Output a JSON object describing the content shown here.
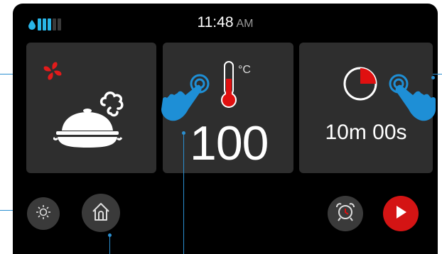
{
  "status_bar": {
    "time": "11:48",
    "ampm": "AM",
    "water_level_bars_filled": 3,
    "water_level_bars_total": 5,
    "water_icon": "water-drop-icon"
  },
  "tiles": {
    "mode": {
      "icons": [
        "convection-fan-icon",
        "covered-dish-steam-icon"
      ]
    },
    "temperature": {
      "value": "100",
      "unit": "°C",
      "icons": [
        "thermometer-icon",
        "tap-hand-icon"
      ]
    },
    "timer": {
      "value": "10m 00s",
      "progress_fraction": 0.25,
      "icons": [
        "timer-icon",
        "tap-hand-icon"
      ]
    }
  },
  "buttons": {
    "light": "sun-icon",
    "home": "home-icon",
    "alarm": "alarm-clock-icon",
    "start": "play-icon"
  },
  "colors": {
    "accent_red": "#d41414",
    "callout_blue": "#2b8fd0",
    "hand_blue": "#1e8fd6",
    "tile_bg": "#2e2e2e",
    "screen_bg": "#000000"
  }
}
